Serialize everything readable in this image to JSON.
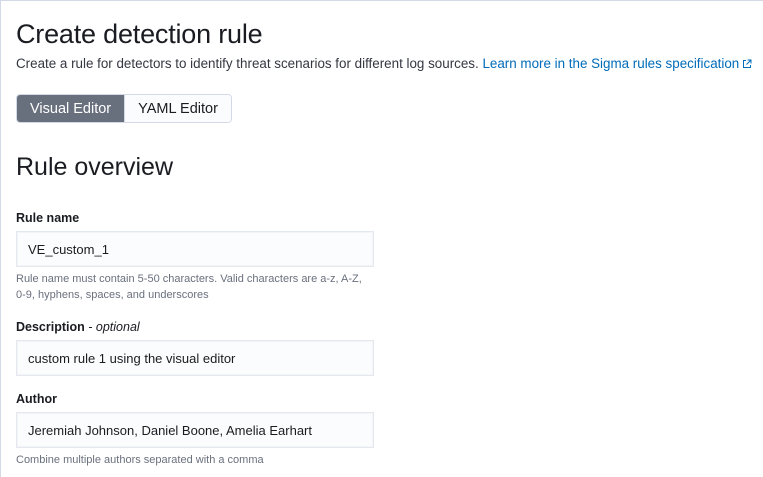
{
  "header": {
    "title": "Create detection rule",
    "subtitle": "Create a rule for detectors to identify threat scenarios for different log sources.",
    "learn_more_link": "Learn more in the Sigma rules specification",
    "external_link_icon": "external-link-icon",
    "link_color": "#006bb8"
  },
  "editor_mode": {
    "options": [
      {
        "label": "Visual Editor",
        "selected": true
      },
      {
        "label": "YAML Editor",
        "selected": false
      }
    ],
    "selected_color": "#69707d"
  },
  "overview": {
    "section_title": "Rule overview",
    "rule_name": {
      "label": "Rule name",
      "value": "VE_custom_1",
      "help_line1": "Rule name must contain 5-50 characters. Valid characters are a-z, A-Z,",
      "help_line2": "0-9, hyphens, spaces, and underscores"
    },
    "description": {
      "label": "Description",
      "optional_label": "- optional",
      "value": "custom rule 1 using the visual editor"
    },
    "author": {
      "label": "Author",
      "value": "Jeremiah Johnson, Daniel Boone, Amelia Earhart",
      "help": "Combine multiple authors separated with a comma"
    }
  }
}
